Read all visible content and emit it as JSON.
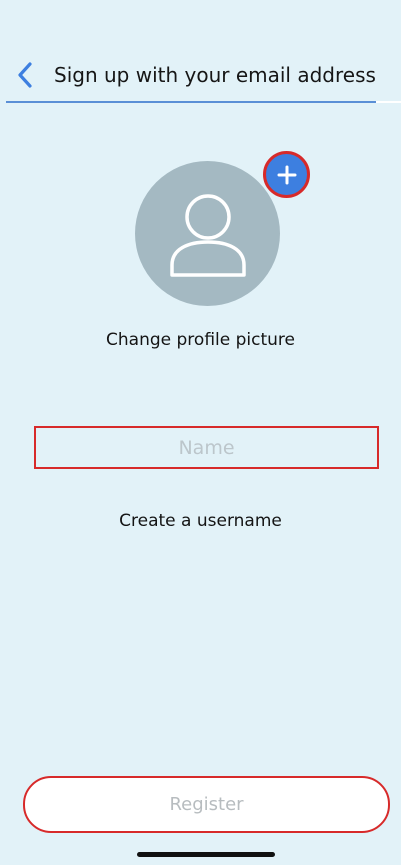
{
  "header": {
    "title": "Sign up with your email address",
    "back_icon": "chevron-left-icon"
  },
  "profile": {
    "avatar_icon": "user-icon",
    "add_icon": "plus-icon",
    "change_label": "Change profile picture"
  },
  "form": {
    "name_placeholder": "Name",
    "name_value": "",
    "username_label": "Create a username"
  },
  "actions": {
    "register_label": "Register"
  },
  "colors": {
    "background": "#e2f2f8",
    "accent": "#3d7fe0",
    "avatar": "#a4b9c2",
    "highlight": "#d72a2a"
  }
}
